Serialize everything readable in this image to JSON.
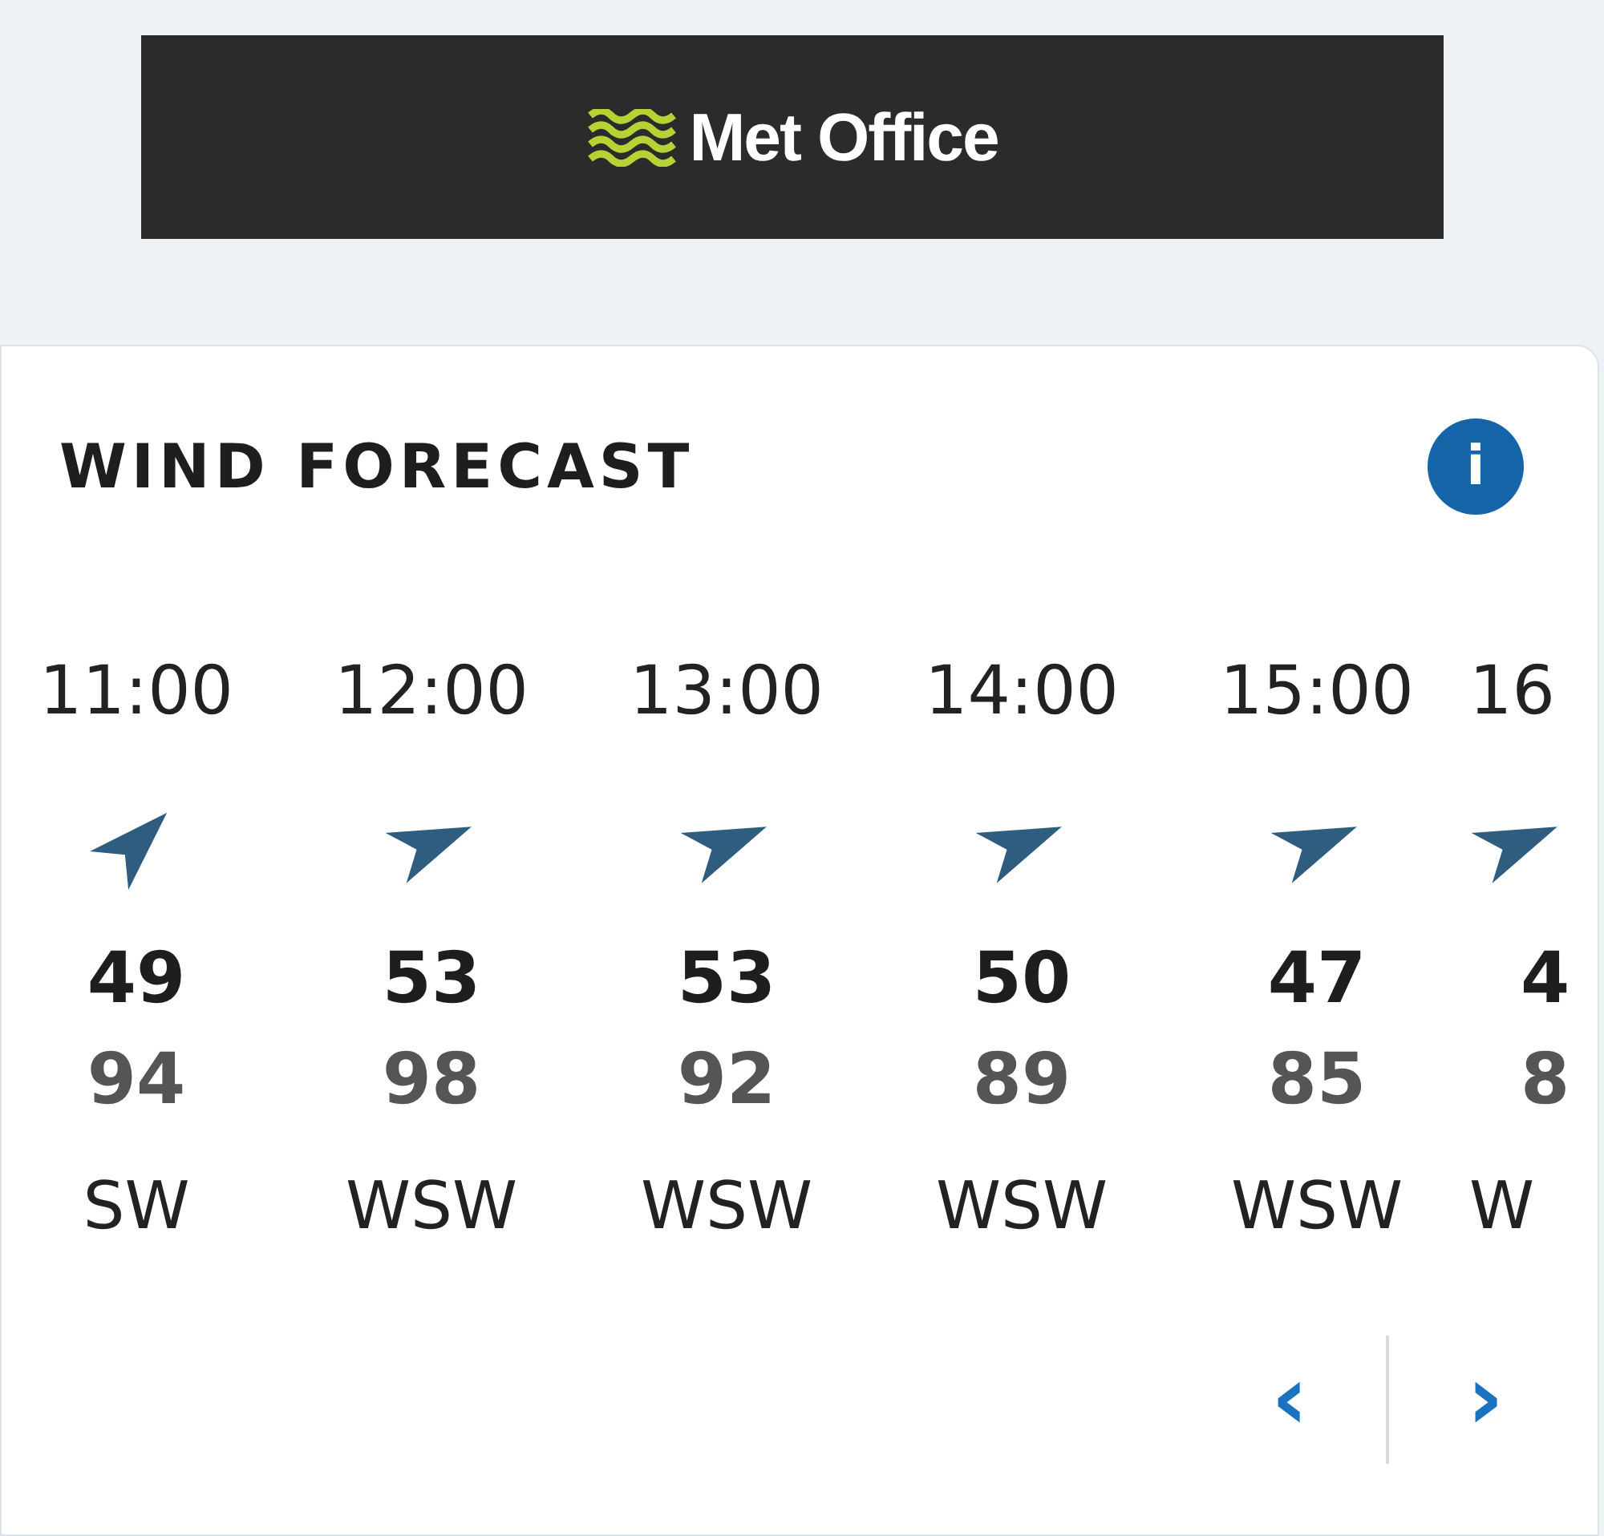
{
  "header": {
    "logo_text": "Met Office"
  },
  "card": {
    "title": "WIND FORECAST",
    "info_button": "i"
  },
  "hours": [
    {
      "time": "11:00",
      "kind": "northeast",
      "speed": "49",
      "gust": "94",
      "direction": "SW"
    },
    {
      "time": "12:00",
      "kind": "eastnortheast",
      "speed": "53",
      "gust": "98",
      "direction": "WSW"
    },
    {
      "time": "13:00",
      "kind": "eastnortheast",
      "speed": "53",
      "gust": "92",
      "direction": "WSW"
    },
    {
      "time": "14:00",
      "kind": "eastnortheast",
      "speed": "50",
      "gust": "89",
      "direction": "WSW"
    },
    {
      "time": "15:00",
      "kind": "eastnortheast",
      "speed": "47",
      "gust": "85",
      "direction": "WSW"
    },
    {
      "time": "16",
      "kind": "eastnortheast",
      "speed": "4",
      "gust": "8",
      "direction": "W"
    }
  ],
  "pager": {
    "prev": "‹",
    "next": "›"
  }
}
